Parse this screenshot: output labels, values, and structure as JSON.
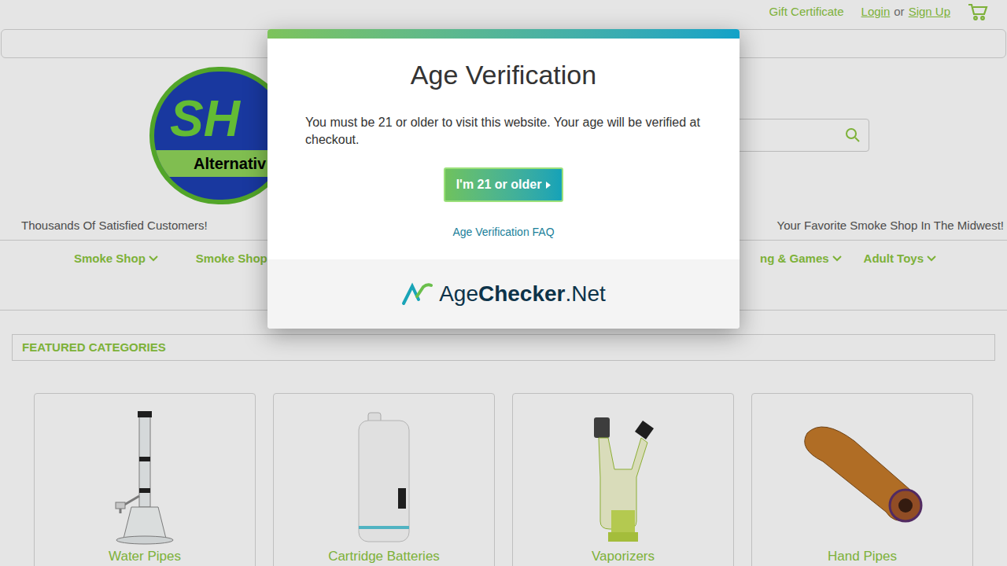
{
  "top_links": {
    "gift": "Gift Certificate",
    "login": "Login",
    "or": "or",
    "signup": "Sign Up"
  },
  "logo": {
    "mark": "SH",
    "sub": "Alternativ"
  },
  "taglines": {
    "left": "Thousands Of Satisfied Customers!",
    "right": "Your Favorite Smoke Shop In The Midwest!"
  },
  "nav": {
    "left": [
      {
        "label": "Smoke Shop"
      },
      {
        "label": "Smoke Shop"
      }
    ],
    "right": [
      {
        "label": "ng & Games"
      },
      {
        "label": "Adult Toys"
      }
    ]
  },
  "featured": {
    "title": "FEATURED CATEGORIES",
    "cards": [
      {
        "label": "Water Pipes",
        "kind": "water-pipe"
      },
      {
        "label": "Cartridge Batteries",
        "kind": "battery"
      },
      {
        "label": "Vaporizers",
        "kind": "vaporizer"
      },
      {
        "label": "Hand Pipes",
        "kind": "hand-pipe"
      }
    ]
  },
  "modal": {
    "title": "Age Verification",
    "message": "You must be 21 or older to visit this website. Your age will be verified at checkout.",
    "button": "I'm 21 or older",
    "faq": "Age Verification FAQ",
    "brand": {
      "age": "Age",
      "checker": "Checker",
      "net": ".Net"
    }
  }
}
